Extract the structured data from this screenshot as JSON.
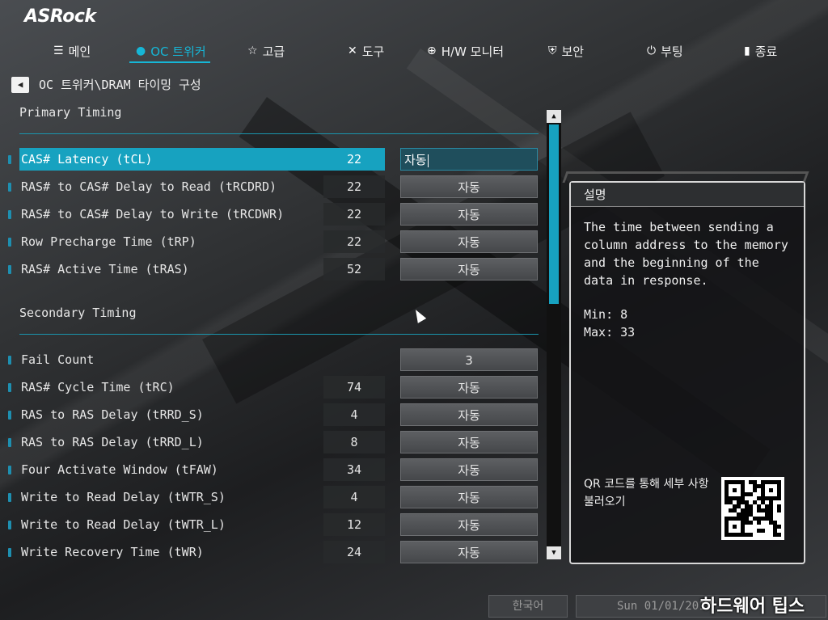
{
  "app": {
    "logo": "ASRock"
  },
  "nav": {
    "tabs": [
      {
        "label": "메인",
        "icon": "list-icon"
      },
      {
        "label": "OC 트위커",
        "icon": "flame-icon",
        "active": true
      },
      {
        "label": "고급",
        "icon": "star-icon"
      },
      {
        "label": "도구",
        "icon": "tools-icon"
      },
      {
        "label": "H/W 모니터",
        "icon": "crosshair-icon"
      },
      {
        "label": "보안",
        "icon": "shield-icon"
      },
      {
        "label": "부팅",
        "icon": "power-icon"
      },
      {
        "label": "종료",
        "icon": "exit-door-icon"
      }
    ]
  },
  "breadcrumb": {
    "text": "OC 트위커\\DRAM 타이밍 구성"
  },
  "sections": {
    "primary": "Primary Timing",
    "secondary": "Secondary Timing"
  },
  "rows": [
    {
      "label": "CAS# Latency (tCL)",
      "current": "22",
      "setting": "자동"
    },
    {
      "label": "RAS# to CAS# Delay to Read  (tRCDRD)",
      "current": "22",
      "setting": "자동"
    },
    {
      "label": "RAS# to CAS# Delay to Write (tRCDWR)",
      "current": "22",
      "setting": "자동"
    },
    {
      "label": "Row Precharge Time (tRP)",
      "current": "22",
      "setting": "자동"
    },
    {
      "label": "RAS# Active Time (tRAS)",
      "current": "52",
      "setting": "자동"
    },
    {
      "label": "Fail Count",
      "current": "",
      "setting": "3"
    },
    {
      "label": "RAS# Cycle Time (tRC)",
      "current": "74",
      "setting": "자동"
    },
    {
      "label": "RAS to RAS Delay (tRRD_S)",
      "current": "4",
      "setting": "자동"
    },
    {
      "label": "RAS to RAS Delay (tRRD_L)",
      "current": "8",
      "setting": "자동"
    },
    {
      "label": "Four Activate Window (tFAW)",
      "current": "34",
      "setting": "자동"
    },
    {
      "label": "Write to Read Delay (tWTR_S)",
      "current": "4",
      "setting": "자동"
    },
    {
      "label": "Write to Read Delay (tWTR_L)",
      "current": "12",
      "setting": "자동"
    },
    {
      "label": "Write Recovery Time (tWR)",
      "current": "24",
      "setting": "자동"
    }
  ],
  "description": {
    "title": "설명",
    "text": "The time between sending a column address to the memory and the beginning of the data in response.",
    "min": "Min: 8",
    "max": "Max: 33",
    "qr_text": "QR 코드를 통해 세부 사항 불러오기"
  },
  "footer": {
    "language": "한국어",
    "datetime": "Sun 01/01/2017",
    "watermark": "하드웨어 팁스"
  },
  "colors": {
    "accent": "#17a2c0",
    "background": "#2a2c2e"
  }
}
